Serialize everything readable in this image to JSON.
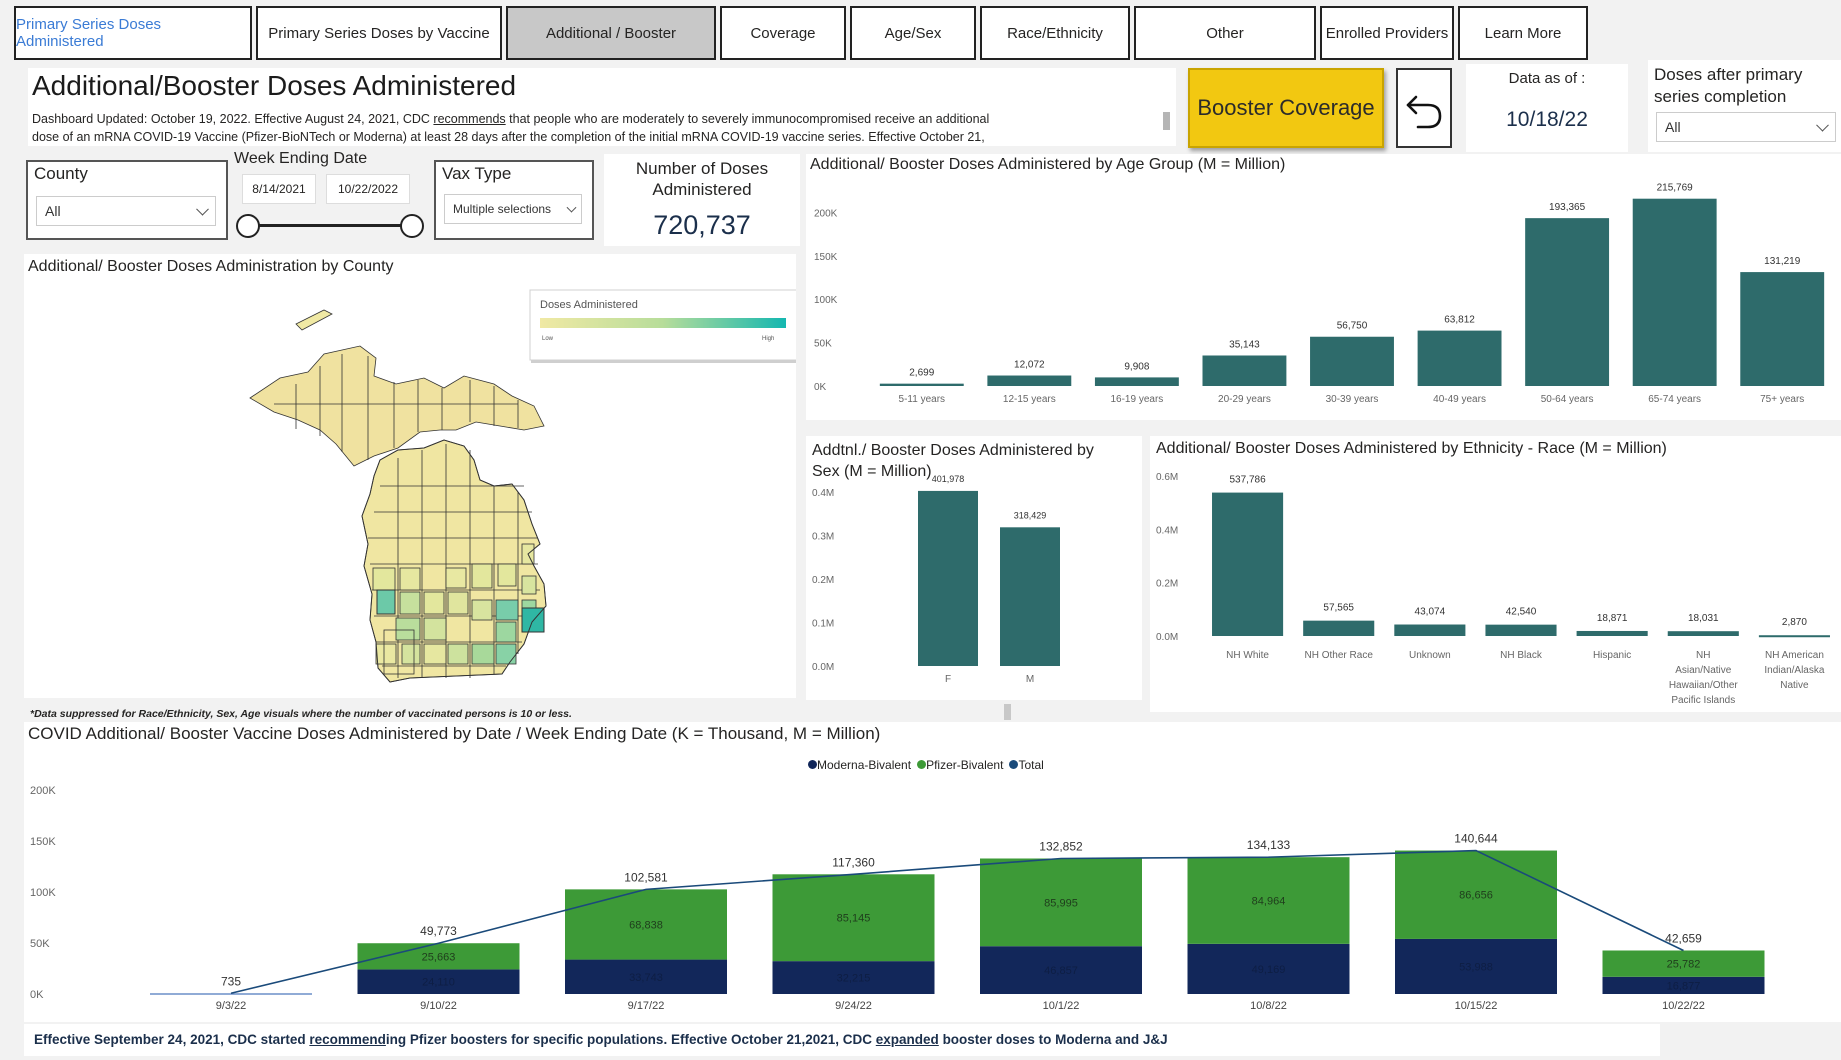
{
  "tabs": [
    {
      "label": "Primary Series Doses Administered",
      "state": "link"
    },
    {
      "label": "Primary Series Doses by Vaccine",
      "state": "normal"
    },
    {
      "label": "Additional / Booster",
      "state": "active"
    },
    {
      "label": "Coverage",
      "state": "normal"
    },
    {
      "label": "Age/Sex",
      "state": "normal"
    },
    {
      "label": "Race/Ethnicity",
      "state": "normal"
    },
    {
      "label": "Other",
      "state": "normal"
    },
    {
      "label": "Enrolled Providers",
      "state": "normal"
    },
    {
      "label": "Learn More",
      "state": "normal"
    }
  ],
  "header": {
    "title": "Additional/Booster Doses Administered",
    "description_line1_a": "Dashboard Updated: October 19, 2022. Effective August 24, 2021, CDC ",
    "description_link": "recommends",
    "description_line1_b": " that people who are moderately to severely immunocompromised receive an additional",
    "description_line2": "dose of an mRNA COVID-19 Vaccine (Pfizer-BioNTech or Moderna) at least 28 days after the completion of the initial mRNA COVID-19 vaccine series. Effective October 21,"
  },
  "booster_button": {
    "label": "Booster Coverage",
    "color": "#f2c811"
  },
  "back_icon": "undo-arrow-icon",
  "data_as_of": {
    "label": "Data as of :",
    "value": "10/18/22"
  },
  "doses_after_primary": {
    "label_line1": "Doses after primary",
    "label_line2": "series completion",
    "value": "All"
  },
  "county_slicer": {
    "label": "County",
    "value": "All"
  },
  "week_ending": {
    "label": "Week Ending Date",
    "start": "8/14/2021",
    "end": "10/22/2022"
  },
  "vax_type": {
    "label": "Vax Type",
    "value": "Multiple selections"
  },
  "kpi": {
    "label_line1": "Number of Doses",
    "label_line2": "Administered",
    "value": "720,737"
  },
  "map": {
    "title": "Additional/ Booster Doses Administration by County",
    "legend_title": "Doses Administered",
    "legend_low": "Low",
    "legend_high": "High",
    "colors": {
      "low": "#f0e9a4",
      "mid": "#b7dd9a",
      "high": "#14b7b0"
    }
  },
  "suppression_note": "*Data suppressed for Race/Ethnicity, Sex, Age visuals where the number of vaccinated persons is 10 or less.",
  "bar_color": "#2e6b6b",
  "age_chart": {
    "title": "Additional/ Booster Doses Administered by Age Group (M = Million)",
    "chart_data": {
      "type": "bar",
      "categories": [
        "5-11 years",
        "12-15 years",
        "16-19 years",
        "20-29 years",
        "30-39 years",
        "40-49 years",
        "50-64 years",
        "65-74 years",
        "75+ years"
      ],
      "values": [
        2699,
        12072,
        9908,
        35143,
        56750,
        63812,
        193365,
        215769,
        131219
      ],
      "data_labels": [
        "2,699",
        "12,072",
        "9,908",
        "35,143",
        "56,750",
        "63,812",
        "193,365",
        "215,769",
        "131,219"
      ],
      "yticks": [
        "0K",
        "50K",
        "100K",
        "150K",
        "200K"
      ],
      "ylim": [
        0,
        235000
      ]
    }
  },
  "sex_chart": {
    "title_line1": "Addtnl./ Booster Doses Administered by",
    "title_line2": "Sex (M = Million)",
    "chart_data": {
      "type": "bar",
      "categories": [
        "F",
        "M"
      ],
      "values": [
        401978,
        318429
      ],
      "data_labels": [
        "401,978",
        "318,429"
      ],
      "yticks": [
        "0.0M",
        "0.1M",
        "0.2M",
        "0.3M",
        "0.4M"
      ],
      "ylim": [
        0,
        450000
      ]
    }
  },
  "race_chart": {
    "title": "Additional/ Booster Doses Administered by Ethnicity - Race (M = Million)",
    "chart_data": {
      "type": "bar",
      "categories": [
        "NH White",
        "NH Other Race",
        "Unknown",
        "NH Black",
        "Hispanic",
        "NH Asian/Native Hawaiian/Other Pacific Islands",
        "NH American Indian/Alaska Native"
      ],
      "category_lines": [
        [
          "NH White"
        ],
        [
          "NH Other Race"
        ],
        [
          "Unknown"
        ],
        [
          "NH Black"
        ],
        [
          "Hispanic"
        ],
        [
          "NH",
          "Asian/Native",
          "Hawaiian/Other",
          "Pacific Islands"
        ],
        [
          "NH American",
          "Indian/Alaska",
          "Native"
        ]
      ],
      "values": [
        537786,
        57565,
        43074,
        42540,
        18871,
        18031,
        2870
      ],
      "data_labels": [
        "537,786",
        "57,565",
        "43,074",
        "42,540",
        "18,871",
        "18,031",
        "2,870"
      ],
      "yticks": [
        "0.0M",
        "0.2M",
        "0.4M",
        "0.6M"
      ],
      "ylim": [
        0,
        600000
      ]
    }
  },
  "weekly_chart": {
    "title": "COVID Additional/ Booster Vaccine Doses Administered by Date / Week Ending Date (K = Thousand, M = Million)",
    "legend": [
      {
        "name": "Moderna-Bivalent",
        "color": "#12275a"
      },
      {
        "name": "Pfizer-Bivalent",
        "color": "#3d9a37"
      },
      {
        "name": "Total",
        "color": "#1a4a7a"
      }
    ],
    "chart_data": {
      "type": "bar",
      "stacked": true,
      "categories": [
        "9/3/22",
        "9/10/22",
        "9/17/22",
        "9/24/22",
        "10/1/22",
        "10/8/22",
        "10/15/22",
        "10/22/22"
      ],
      "series": [
        {
          "name": "Moderna-Bivalent",
          "values": [
            0,
            24110,
            33743,
            32215,
            46857,
            49169,
            53988,
            16877
          ]
        },
        {
          "name": "Pfizer-Bivalent",
          "values": [
            735,
            25663,
            68838,
            85145,
            85995,
            84964,
            86656,
            25782
          ]
        },
        {
          "name": "Total",
          "values": [
            735,
            49773,
            102581,
            117360,
            132852,
            134133,
            140644,
            42659
          ]
        }
      ],
      "moderna_labels": [
        "",
        "24,110",
        "33,743",
        "32,215",
        "46,857",
        "49,169",
        "53,988",
        "16,877"
      ],
      "pfizer_labels": [
        "",
        "25,663",
        "68,838",
        "85,145",
        "85,995",
        "84,964",
        "86,656",
        "25,782"
      ],
      "total_labels": [
        "735",
        "49,773",
        "102,581",
        "117,360",
        "132,852",
        "134,133",
        "140,644",
        "42,659"
      ],
      "yticks": [
        "0K",
        "50K",
        "100K",
        "150K",
        "200K"
      ],
      "ylim": [
        0,
        200000
      ]
    }
  },
  "footer": {
    "a": "Effective September 24, 2021, CDC started ",
    "link1": "recommend",
    "b": "ing Pfizer boosters for specific populations. Effective October 21,2021, CDC ",
    "link2": "expanded",
    "c": " booster doses to Moderna and J&J"
  }
}
